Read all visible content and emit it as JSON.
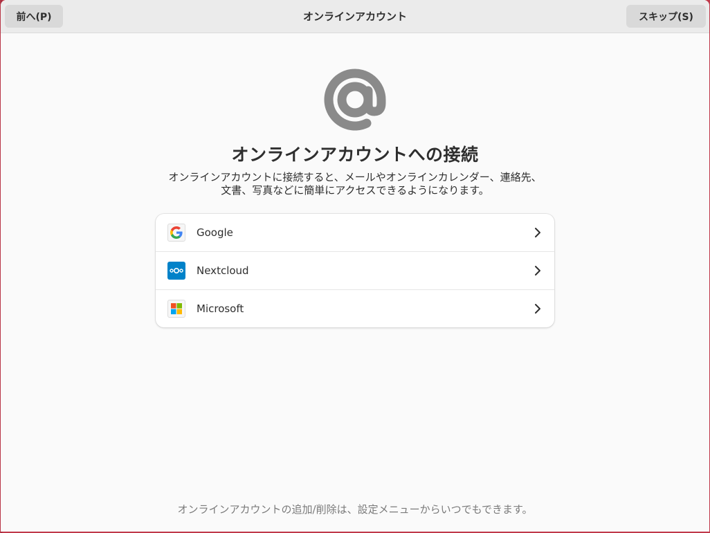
{
  "header": {
    "prev_label": "前へ(P)",
    "title": "オンラインアカウント",
    "skip_label": "スキップ(S)"
  },
  "hero": {
    "icon": "at-sign-icon",
    "title": "オンラインアカウントへの接続",
    "description_line1": "オンラインアカウントに接続すると、メールやオンラインカレンダー、連絡先、",
    "description_line2": "文書、写真などに簡単にアクセスできるようになります。"
  },
  "providers": [
    {
      "label": "Google",
      "icon": "google-icon"
    },
    {
      "label": "Nextcloud",
      "icon": "nextcloud-icon"
    },
    {
      "label": "Microsoft",
      "icon": "microsoft-icon"
    }
  ],
  "footer": {
    "text": "オンラインアカウントの追加/削除は、設定メニューからいつでもできます。"
  },
  "colors": {
    "window_bg": "#fafafa",
    "header_bg": "#ebebeb",
    "button_bg": "#d9d9d9",
    "at_icon": "#8a8a8a",
    "nextcloud_blue": "#0082c9",
    "desktop_bg": "#c0394a"
  }
}
